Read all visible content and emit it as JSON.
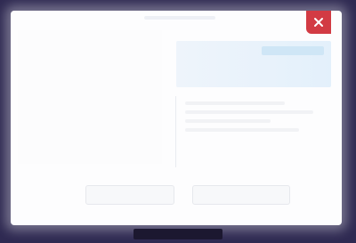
{
  "window": {
    "close_icon": "close-icon"
  },
  "theme": {
    "accent_close": "#d23b44",
    "background": "#2f2a52"
  }
}
